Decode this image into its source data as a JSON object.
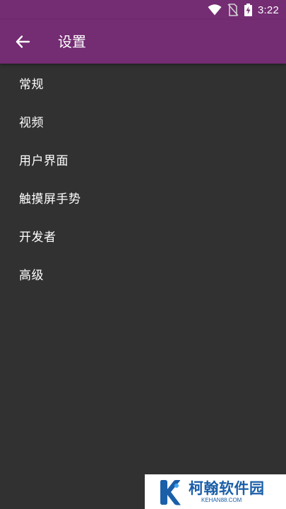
{
  "status_bar": {
    "time": "3:22",
    "icons": [
      "wifi-icon",
      "no-sim-icon",
      "battery-charging-icon"
    ]
  },
  "app_bar": {
    "title": "设置",
    "back_icon": "arrow-left-icon"
  },
  "settings": {
    "items": [
      {
        "label": "常规"
      },
      {
        "label": "视频"
      },
      {
        "label": "用户界面"
      },
      {
        "label": "触摸屏手势"
      },
      {
        "label": "开发者"
      },
      {
        "label": "高级"
      }
    ]
  },
  "watermark": {
    "title": "柯翰软件园",
    "subtitle": "KEHAN88.COM"
  },
  "colors": {
    "accent": "#742c73",
    "background": "#313131",
    "text": "#ffffff",
    "watermark_blue": "#1b5fa8"
  }
}
